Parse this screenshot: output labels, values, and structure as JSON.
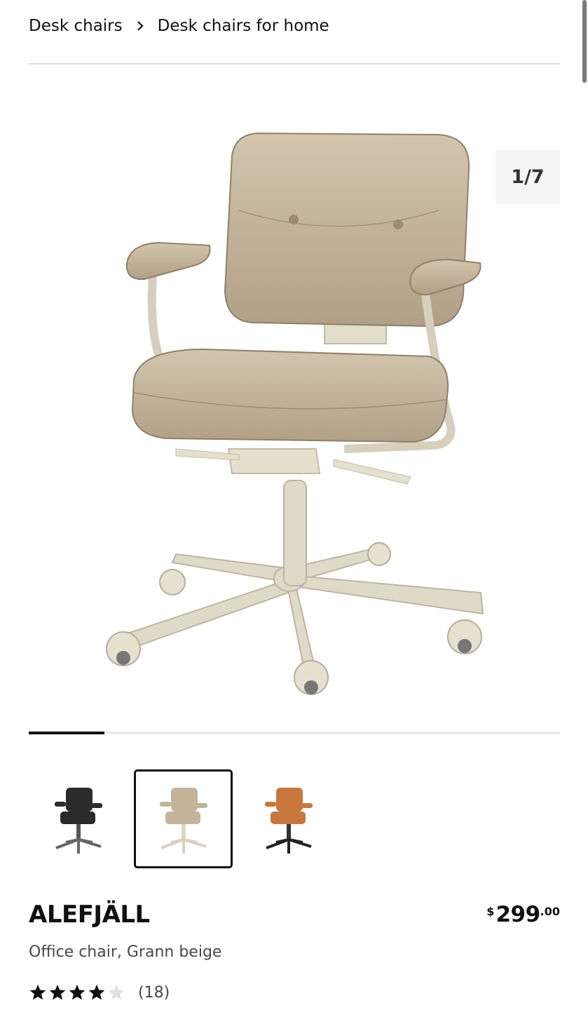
{
  "breadcrumb": {
    "items": [
      {
        "label": "Desk chairs"
      },
      {
        "label": "Desk chairs for home"
      }
    ]
  },
  "gallery": {
    "counter": "1/7",
    "current_index": 1,
    "total": 7,
    "main_image": "beige-office-chair-image",
    "progress_fraction": 0.143
  },
  "variants": [
    {
      "name": "black-chair-thumbnail",
      "color": "#2b2b2b",
      "selected": false
    },
    {
      "name": "beige-chair-thumbnail",
      "color": "#c2b39a",
      "selected": true
    },
    {
      "name": "brown-chair-thumbnail",
      "color": "#c7773d",
      "selected": false
    }
  ],
  "product": {
    "name": "ALEFJÄLL",
    "description": "Office chair, Grann beige",
    "price": {
      "currency": "$",
      "integer": "299",
      "decimal": ".00"
    },
    "rating": {
      "stars": 4,
      "max": 5,
      "count": "(18)"
    }
  },
  "colors": {
    "text": "#111111",
    "muted": "#484848",
    "star_filled": "#111111",
    "star_empty": "#dfdfdf"
  }
}
